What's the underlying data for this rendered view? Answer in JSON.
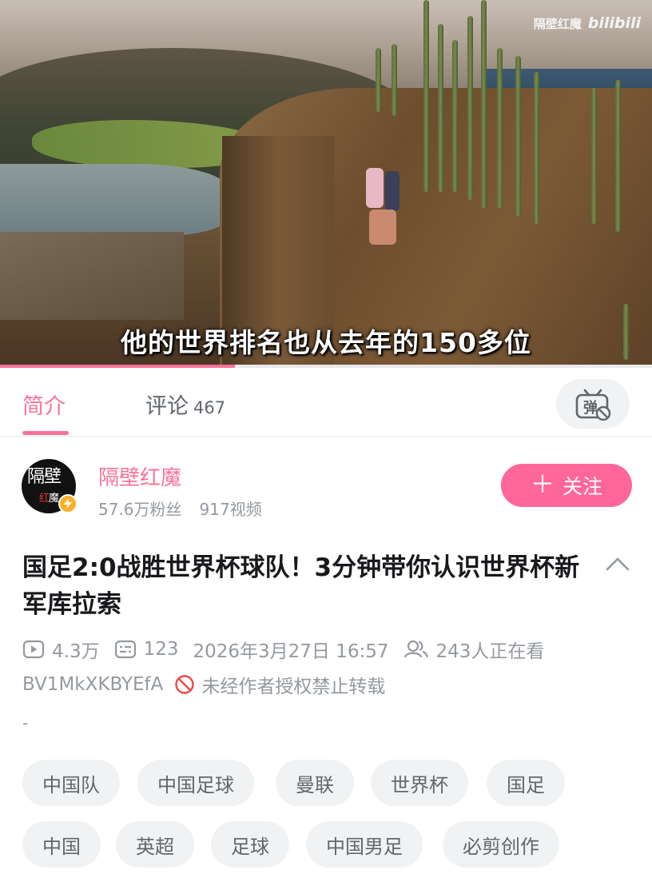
{
  "video": {
    "subtitle": "他的世界排名也从去年的150多位",
    "watermark_name": "隔壁红魔",
    "watermark_logo": "bilibili",
    "progress": 0.36
  },
  "tabs": {
    "intro_label": "简介",
    "comments_label": "评论",
    "comments_count": "467",
    "danmaku_icon": "danmaku-off-icon",
    "danmaku_glyph": "弹"
  },
  "uploader": {
    "avatar_text_line1": "隔壁",
    "avatar_text_line2_a": "红",
    "avatar_text_line2_b": "魔",
    "verify_icon": "lightning-icon",
    "name": "隔壁红魔",
    "followers": "57.6万粉丝",
    "videos": "917视频",
    "follow_button": "关注",
    "follow_icon": "plus-icon"
  },
  "video_info": {
    "title": "国足2:0战胜世界杯球队！3分钟带你认识世界杯新军库拉索",
    "views": "4.3万",
    "danmaku_count": "123",
    "publish_time": "2026年3月27日 16:57",
    "watching": "243人正在看",
    "bvid": "BV1MkXKBYEfA",
    "repost_notice": "未经作者授权禁止转载",
    "description": "-"
  },
  "tags": [
    "中国队",
    "中国足球",
    "曼联",
    "世界杯",
    "国足",
    "中国",
    "英超",
    "足球",
    "中国男足",
    "必剪创作"
  ],
  "colors": {
    "accent": "#fb7299",
    "follow_button": "#ff6699",
    "secondary_text": "#9499a0",
    "tag_bg": "#f1f2f3"
  }
}
